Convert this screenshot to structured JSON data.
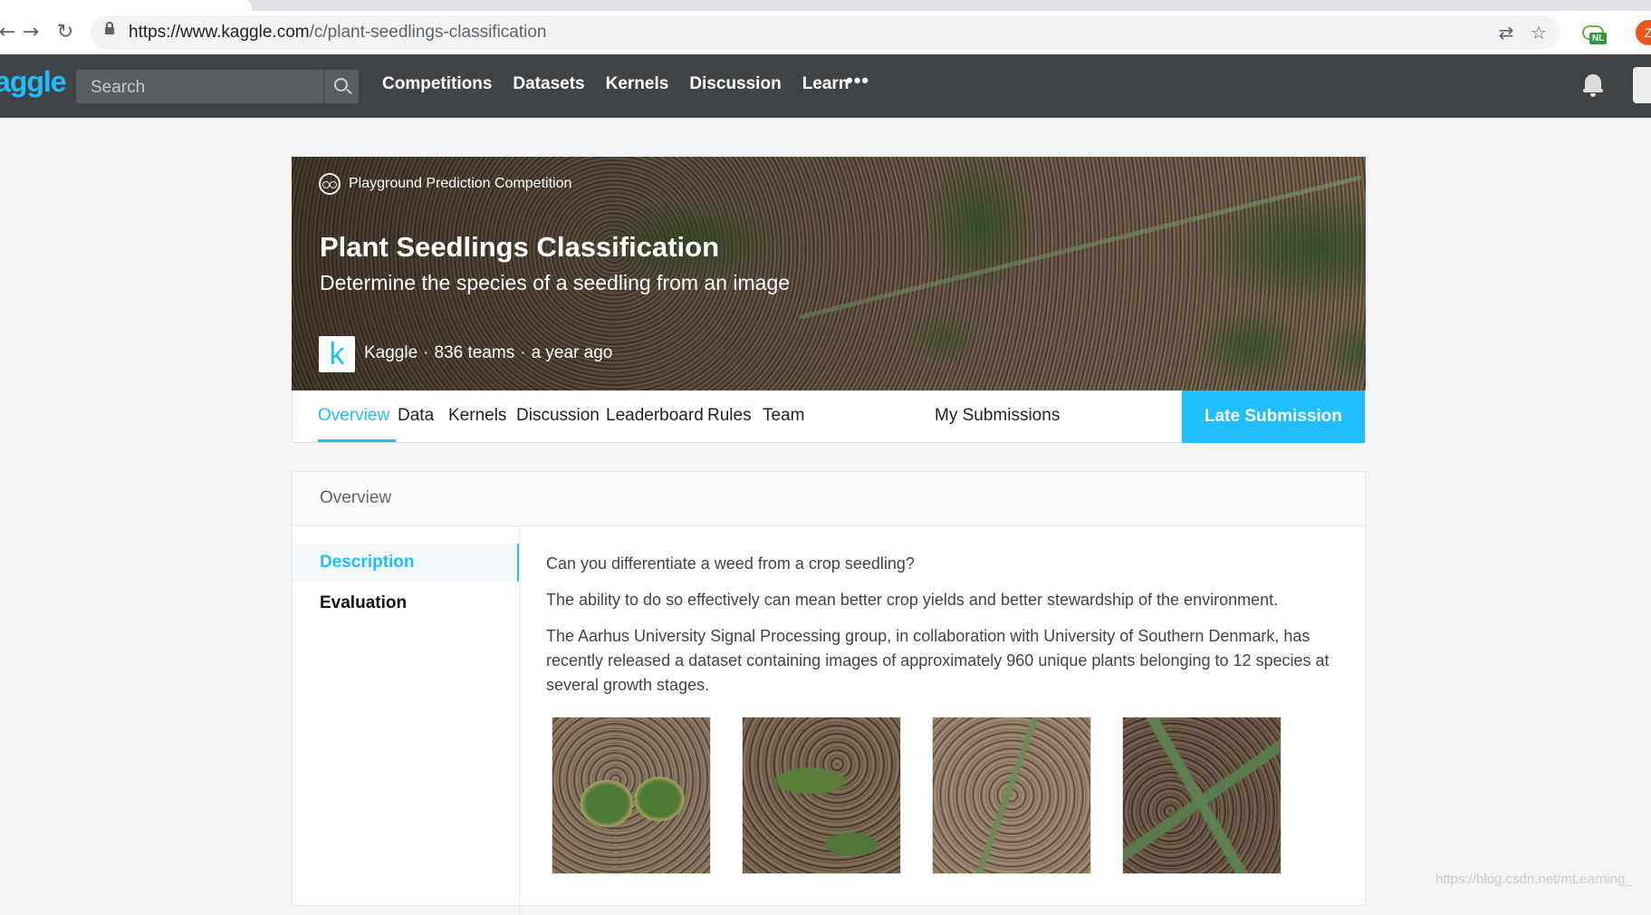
{
  "browser": {
    "url_host": "https://www.kaggle.com",
    "url_path": "/c/plant-seedlings-classification",
    "ext_badge": "NL",
    "profile_initial": "Z"
  },
  "header": {
    "logo": "aggle",
    "search_placeholder": "Search",
    "nav": [
      "Competitions",
      "Datasets",
      "Kernels",
      "Discussion",
      "Learn"
    ],
    "more": "•••"
  },
  "competition": {
    "type": "Playground Prediction Competition",
    "title": "Plant Seedlings Classification",
    "subtitle": "Determine the species of a seedling from an image",
    "host_logo": "k",
    "host": "Kaggle",
    "teams": "836 teams",
    "when": "a year ago",
    "tabs": [
      "Overview",
      "Data",
      "Kernels",
      "Discussion",
      "Leaderboard",
      "Rules",
      "Team"
    ],
    "my_submissions": "My Submissions",
    "late_submission": "Late Submission"
  },
  "overview": {
    "title": "Overview",
    "side": [
      "Description",
      "Evaluation"
    ],
    "paragraphs": [
      "Can you differentiate a weed from a crop seedling?",
      "The ability to do so effectively can mean better crop yields and better stewardship of the environment.",
      "The Aarhus University Signal Processing group, in collaboration with University of Southern Denmark, has recently released a dataset containing images of approximately 960 unique plants belonging to 12 species at several growth stages."
    ]
  },
  "watermark": "https://blog.csdn.net/mLearning_"
}
